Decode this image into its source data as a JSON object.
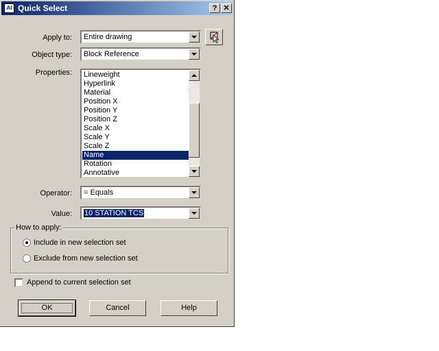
{
  "window": {
    "title": "Quick Select",
    "help_btn": "?",
    "close_btn": "✕"
  },
  "labels": {
    "apply_to": "Apply to:",
    "object_type": "Object type:",
    "properties": "Properties:",
    "operator": "Operator:",
    "value": "Value:"
  },
  "fields": {
    "apply_to": "Entire drawing",
    "object_type": "Block Reference",
    "operator": "= Equals",
    "value": "10 STATION TCS"
  },
  "properties": [
    "Lineweight",
    "Hyperlink",
    "Material",
    "Position X",
    "Position Y",
    "Position Z",
    "Scale X",
    "Scale Y",
    "Scale Z",
    "Name",
    "Rotation",
    "Annotative"
  ],
  "properties_selected": "Name",
  "how_to_apply": {
    "title": "How to apply:",
    "include": "Include in new selection set",
    "exclude": "Exclude from new selection set",
    "selected": "include"
  },
  "append_label": "Append to current selection set",
  "buttons": {
    "ok": "OK",
    "cancel": "Cancel",
    "help": "Help"
  },
  "colors": {
    "face": "#d4d0c8",
    "title_start": "#0a246a",
    "title_end": "#a6caf0",
    "highlight": "#0a246a"
  }
}
